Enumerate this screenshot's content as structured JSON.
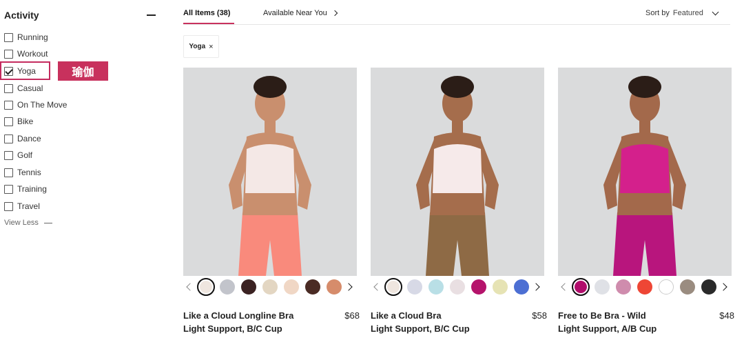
{
  "sidebar": {
    "title": "Activity",
    "items": [
      {
        "label": "Running",
        "checked": false
      },
      {
        "label": "Workout",
        "checked": false
      },
      {
        "label": "Yoga",
        "checked": true
      },
      {
        "label": "Casual",
        "checked": false
      },
      {
        "label": "On The Move",
        "checked": false
      },
      {
        "label": "Bike",
        "checked": false
      },
      {
        "label": "Dance",
        "checked": false
      },
      {
        "label": "Golf",
        "checked": false
      },
      {
        "label": "Tennis",
        "checked": false
      },
      {
        "label": "Training",
        "checked": false
      },
      {
        "label": "Travel",
        "checked": false
      }
    ],
    "annotation_label": "瑜伽",
    "view_less": "View Less"
  },
  "tabs": {
    "all_items": "All Items (38)",
    "near_you": "Available Near You"
  },
  "sort": {
    "label": "Sort by",
    "value": "Featured"
  },
  "filter_chip": {
    "label": "Yoga",
    "remove": "×"
  },
  "products": [
    {
      "name_line1": "Like a Cloud Longline Bra",
      "name_line2": "Light Support, B/C Cup",
      "price": "$68",
      "top_color": "#f4e8e6",
      "bottom_color": "#f98a7c",
      "skin": "#c98f6e",
      "swatches": [
        "#efe6df",
        "#c2c4cb",
        "#3b2222",
        "#e3d6c2",
        "#f0d7c5",
        "#4a2b24",
        "#d68c6b"
      ]
    },
    {
      "name_line1": "Like a Cloud Bra",
      "name_line2": "Light Support, B/C Cup",
      "price": "$58",
      "top_color": "#f6eaea",
      "bottom_color": "#8e6a45",
      "skin": "#a56d4c",
      "swatches": [
        "#efe6df",
        "#d7d9e6",
        "#b9dfe6",
        "#e9dfe2",
        "#b5136b",
        "#e6e3b4",
        "#4c6fd3"
      ]
    },
    {
      "name_line1": "Free to Be Bra - Wild",
      "name_line2": "Light Support, A/B Cup",
      "price": "$48",
      "top_color": "#d4208c",
      "bottom_color": "#b8157d",
      "skin": "#a3694b",
      "swatches": [
        "#b10c6b",
        "#dfe1e6",
        "#cf8cad",
        "#ee4635",
        "#ffffff",
        "#9a8c80",
        "#2a2a2a"
      ]
    }
  ]
}
